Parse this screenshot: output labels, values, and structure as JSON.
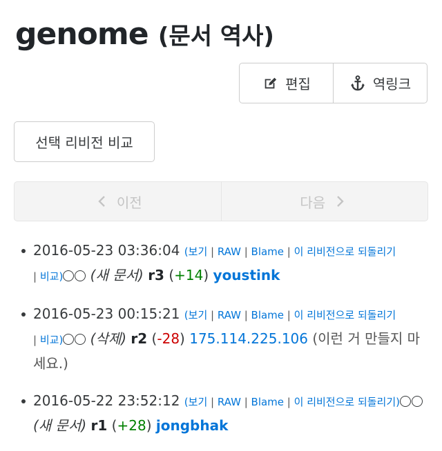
{
  "page": {
    "title": "genome",
    "subtitle": "(문서 역사)"
  },
  "toolbar": {
    "edit_label": "편집",
    "backlinks_label": "역링크"
  },
  "compare_button": "선택 리비전 비교",
  "pager": {
    "prev_label": "이전",
    "next_label": "다음"
  },
  "history": [
    {
      "date": "2016-05-23 03:36:04",
      "links": [
        "보기",
        "RAW",
        "Blame",
        "이 리비전으로 되돌리기",
        "비교"
      ],
      "tag": "(새 문서)",
      "rev": "r3",
      "change": "+14",
      "author": "youstink"
    },
    {
      "date": "2016-05-23 00:15:21",
      "links": [
        "보기",
        "RAW",
        "Blame",
        "이 리비전으로 되돌리기",
        "비교"
      ],
      "tag": "(삭제)",
      "rev": "r2",
      "change": "-28",
      "author": "175.114.225.106",
      "note": "(이런 거 만들지 마세요.)"
    },
    {
      "date": "2016-05-22 23:52:12",
      "links": [
        "보기",
        "RAW",
        "Blame",
        "이 리비전으로 되돌리기"
      ],
      "tag": "(새 문서)",
      "rev": "r1",
      "change": "+28",
      "author": "jongbhak"
    }
  ],
  "colors": {
    "link": "#0275d8",
    "positive": "#008000",
    "negative": "#cc0000"
  }
}
